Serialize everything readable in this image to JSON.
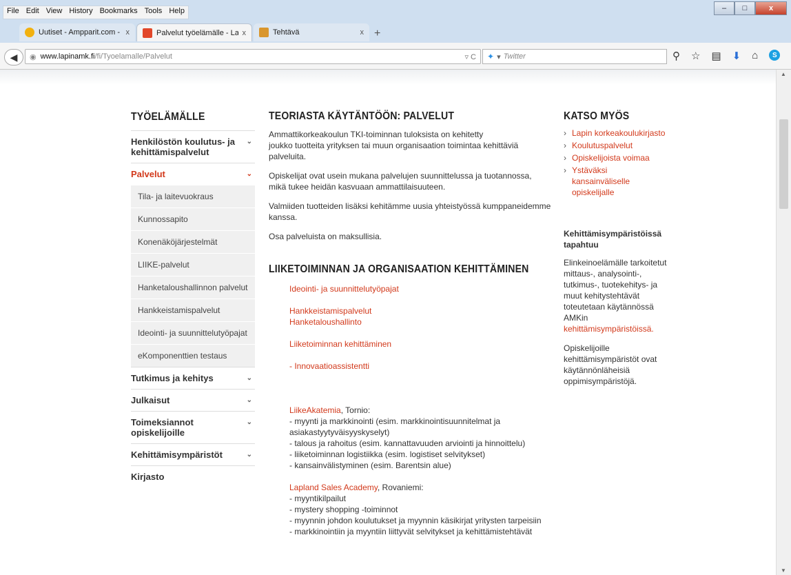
{
  "menu": [
    "File",
    "Edit",
    "View",
    "History",
    "Bookmarks",
    "Tools",
    "Help"
  ],
  "window_controls": {
    "minimize": "–",
    "maximize": "□",
    "close": "x"
  },
  "tabs": [
    {
      "title": "Uutiset - Ampparit.com - S...",
      "close": "x",
      "icon_color": "#f2b10f"
    },
    {
      "title": "Palvelut työelämälle - Lapi...",
      "close": "x",
      "icon_color": "#e2472a"
    },
    {
      "title": "Tehtävä",
      "close": "x",
      "icon_color": "#d9962d"
    }
  ],
  "new_tab": "+",
  "url": {
    "host": "www.lapinamk.fi",
    "path": "/fi/Tyoelamalle/Palvelut"
  },
  "search": {
    "engine": "Twitter",
    "placeholder": "Twitter"
  },
  "sidebar": {
    "title": "TYÖELÄMÄLLE",
    "items": [
      {
        "label": "Henkilöstön koulutus- ja kehittämispalvelut",
        "active": false
      },
      {
        "label": "Palvelut",
        "active": true
      }
    ],
    "subitems": [
      "Tila- ja laitevuokraus",
      "Kunnossapito",
      "Konenäköjärjestelmät",
      "LIIKE-palvelut",
      "Hanketaloushallinnon palvelut",
      "Hankkeistamispalvelut",
      "Ideointi- ja suunnittelutyöpajat",
      "eKomponenttien testaus"
    ],
    "items_after": [
      "Tutkimus ja kehitys",
      "Julkaisut",
      "Toimeksiannot opiskelijoille",
      "Kehittämisympäristöt",
      "Kirjasto"
    ]
  },
  "main": {
    "title": "TEORIASTA KÄYTÄNTÖÖN: PALVELUT",
    "intro_line1": "Ammattikorkeakoulun TKI-toiminnan tuloksista on kehitetty",
    "intro_line2": "joukko tuotteita yrityksen tai muun organisaation toimintaa kehittäviä palveluita.",
    "p2": "Opiskelijat ovat usein mukana palvelujen suunnittelussa ja tuotannossa, mikä tukee heidän kasvuaan ammattilaisuuteen.",
    "p3": "Valmiiden tuotteiden lisäksi kehitämme uusia yhteistyössä kumppaneidemme kanssa.",
    "p4": "Osa palveluista on maksullisia.",
    "section_title": "LIIKETOIMINNAN JA ORGANISAATION KEHITTÄMINEN",
    "links": {
      "ideointi": "Ideointi- ja suunnittelutyöpajat",
      "hankkeistamis": "Hankkeistamispalvelut",
      "hanketalous": "Hanketaloushallinto",
      "liiketoiminnan": "Liiketoiminnan kehittäminen",
      "innovaatio": "- Innovaatioassistentti"
    },
    "liikeakatemia": {
      "name": "LiikeAkatemia",
      "place": ", Tornio:",
      "lines": [
        "- myynti ja markkinointi (esim. markkinointisuunnitelmat ja asiakastyytyväisyyskyselyt)",
        "- talous ja rahoitus (esim. kannattavuuden arviointi ja hinnoittelu)",
        "- liiketoiminnan logistiikka (esim. logistiset selvitykset)",
        "- kansainvälistyminen (esim. Barentsin alue)"
      ]
    },
    "lsa": {
      "name": "Lapland Sales Academy",
      "place": ", Rovaniemi:",
      "lines": [
        "- myyntikilpailut",
        "- mystery shopping -toiminnot",
        "- myynnin johdon koulutukset ja myynnin käsikirjat yritysten tarpeisiin",
        "- markkinointiin ja myyntiin liittyvät selvitykset ja kehittämistehtävät"
      ]
    }
  },
  "rail": {
    "title": "KATSO MYÖS",
    "links": [
      "Lapin korkeakoulukirjasto",
      "Koulutuspalvelut",
      "Opiskelijoista voimaa",
      "Ystäväksi kansainväliselle opiskelijalle"
    ],
    "subheading": "Kehittämisympäristöissä tapahtuu",
    "p1_text": "Elinkeinoelämälle tarkoitetut mittaus-, analysointi-, tutkimus-, tuotekehitys- ja muut kehitystehtävät toteutetaan käytännössä AMKin",
    "p1_link": "kehittämisympäristöissä.",
    "p2": "Opiskelijoille kehittämisympäristöt ovat käytännönläheisiä oppimisympäristöjä."
  }
}
